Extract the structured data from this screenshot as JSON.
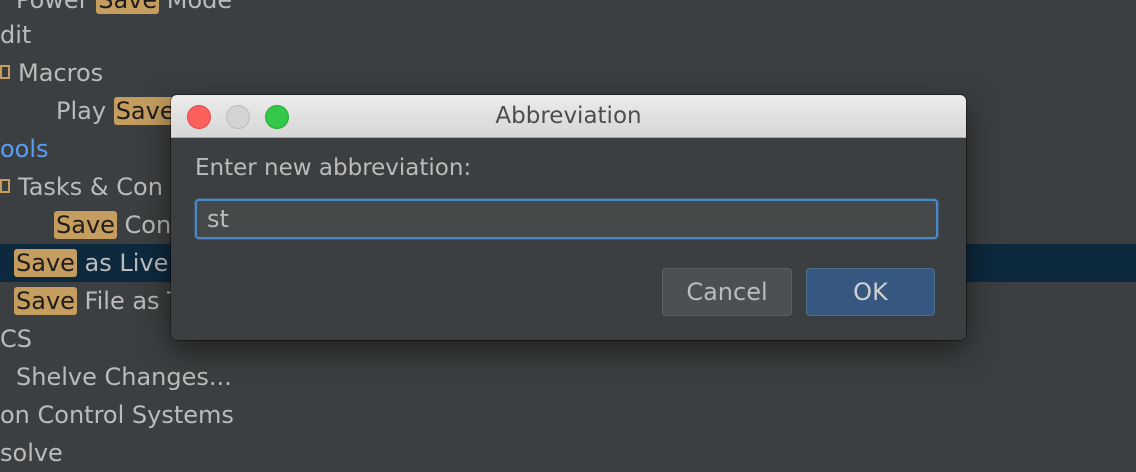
{
  "background_tree": {
    "rows": [
      {
        "before": "Power ",
        "highlight": "Save",
        "after": " Mode"
      },
      {
        "before": "dit",
        "highlight": "",
        "after": ""
      },
      {
        "before": "Macros",
        "highlight": "",
        "after": ""
      },
      {
        "before": "Play ",
        "highlight": "Save",
        "after": ""
      },
      {
        "before": "ools",
        "highlight": "",
        "after": ""
      },
      {
        "before": "Tasks & Con",
        "highlight": "",
        "after": ""
      },
      {
        "before": "",
        "highlight": "Save",
        "after": " Con"
      },
      {
        "before": "",
        "highlight": "Save",
        "after": " as Live"
      },
      {
        "before": "",
        "highlight": "Save",
        "after": " File as T"
      },
      {
        "before": "CS",
        "highlight": "",
        "after": ""
      },
      {
        "before": "Shelve Changes...",
        "highlight": "",
        "after": ""
      },
      {
        "before": "on Control Systems",
        "highlight": "",
        "after": ""
      },
      {
        "before": "solve",
        "highlight": "",
        "after": ""
      }
    ]
  },
  "dialog": {
    "title": "Abbreviation",
    "prompt": "Enter new abbreviation:",
    "input_value": "st",
    "cancel_label": "Cancel",
    "ok_label": "OK"
  }
}
